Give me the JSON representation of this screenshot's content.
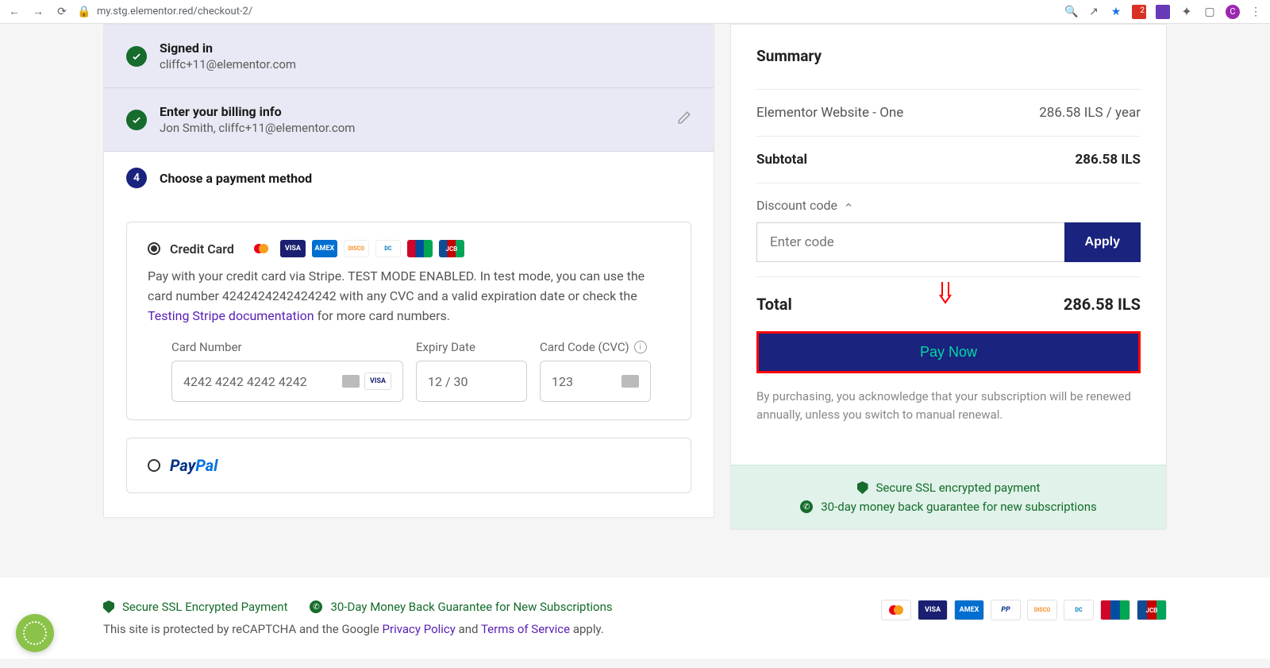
{
  "browser": {
    "url": "my.stg.elementor.red/checkout-2/",
    "avatar_letter": "C"
  },
  "steps": {
    "signed_in": {
      "title": "Signed in",
      "email": "cliffc+11@elementor.com"
    },
    "billing": {
      "title": "Enter your billing info",
      "sub": "Jon Smith, cliffc+11@elementor.com"
    },
    "payment": {
      "number": "4",
      "title": "Choose a payment method",
      "cc_label": "Credit Card",
      "cc_text_prefix": "Pay with your credit card via Stripe. TEST MODE ENABLED. In test mode, you can use the card number 4242424242424242 with any CVC and a valid expiration date or check the ",
      "cc_link": "Testing Stripe documentation",
      "cc_text_suffix": " for more card numbers.",
      "card_number_label": "Card Number",
      "card_number_value": "4242 4242 4242 4242",
      "expiry_label": "Expiry Date",
      "expiry_value": "12 / 30",
      "cvc_label": "Card Code (CVC)",
      "cvc_value": "123",
      "paypal_label": "PayPal"
    }
  },
  "summary": {
    "title": "Summary",
    "item_name": "Elementor Website - One",
    "item_price": "286.58 ILS / year",
    "subtotal_label": "Subtotal",
    "subtotal_value": "286.58 ILS",
    "discount_label": "Discount code",
    "discount_placeholder": "Enter code",
    "apply_label": "Apply",
    "total_label": "Total",
    "total_value": "286.58 ILS",
    "paynow_label": "Pay Now",
    "ack_text": "By purchasing, you acknowledge that your subscription will be renewed annually, unless you switch to manual renewal.",
    "secure_ssl": "Secure SSL encrypted payment",
    "guarantee": "30-day money back guarantee for new subscriptions"
  },
  "footer": {
    "secure_ssl": "Secure SSL Encrypted Payment",
    "guarantee": "30-Day Money Back Guarantee for New Subscriptions",
    "legal_prefix": "This site is protected by reCAPTCHA and the Google ",
    "privacy": "Privacy Policy",
    "and": " and ",
    "tos": "Terms of Service",
    "apply": " apply."
  }
}
